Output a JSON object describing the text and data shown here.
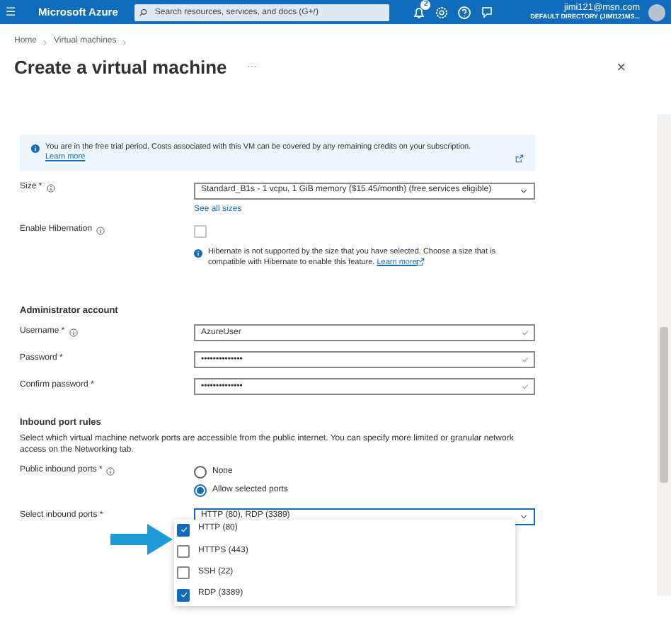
{
  "topbar": {
    "menu": "☰",
    "brand": "Microsoft Azure",
    "search": {
      "placeholder": "Search resources, services, and docs (G+/)"
    },
    "notification_count": "2",
    "user": {
      "email": "jimi121@msn.com",
      "directory": "DEFAULT DIRECTORY (JIMI121MS..."
    }
  },
  "breadcrumb": [
    {
      "label": "Home"
    },
    {
      "label": "Virtual machines"
    }
  ],
  "title": "Create a virtual machine",
  "more": "···",
  "close": "×",
  "info": {
    "text": "You are in the free trial period. Costs associated with this VM can be covered by any remaining credits on your subscription.",
    "link": "Learn more"
  },
  "size": {
    "label": "Size *",
    "value": "Standard_B1s - 1 vcpu, 1 GiB memory ($15.45/month) (free services eligible)",
    "link": "See all sizes"
  },
  "hibernation": {
    "label": "Enable Hibernation",
    "checked": false,
    "disabled": true,
    "note": "Hibernate is not supported by the size that you have selected. Choose a size that is compatible with Hibernate to enable this feature.",
    "link": "Learn more"
  },
  "admin": {
    "heading": "Administrator account",
    "fields": [
      {
        "label": "Username *",
        "info": true,
        "value": "AzureUser",
        "valid": true
      },
      {
        "label": "Password *",
        "info": false,
        "value": "••••••••••••••",
        "valid": true
      },
      {
        "label": "Confirm password *",
        "info": false,
        "value": "••••••••••••••",
        "valid": true
      }
    ]
  },
  "inbound": {
    "heading": "Inbound port rules",
    "description": "Select which virtual machine network ports are accessible from the public internet. You can specify more limited or granular network access on the Networking tab.",
    "public_label": "Public inbound ports *",
    "options": [
      {
        "label": "None",
        "selected": false
      },
      {
        "label": "Allow selected ports",
        "selected": true
      }
    ],
    "select_label": "Select inbound ports *",
    "select_value": "HTTP (80), RDP (3389)",
    "expanded": true,
    "ports": [
      {
        "label": "HTTP (80)",
        "checked": true
      },
      {
        "label": "HTTPS (443)",
        "checked": false
      },
      {
        "label": "SSH (22)",
        "checked": false
      },
      {
        "label": "RDP (3389)",
        "checked": true
      }
    ]
  }
}
